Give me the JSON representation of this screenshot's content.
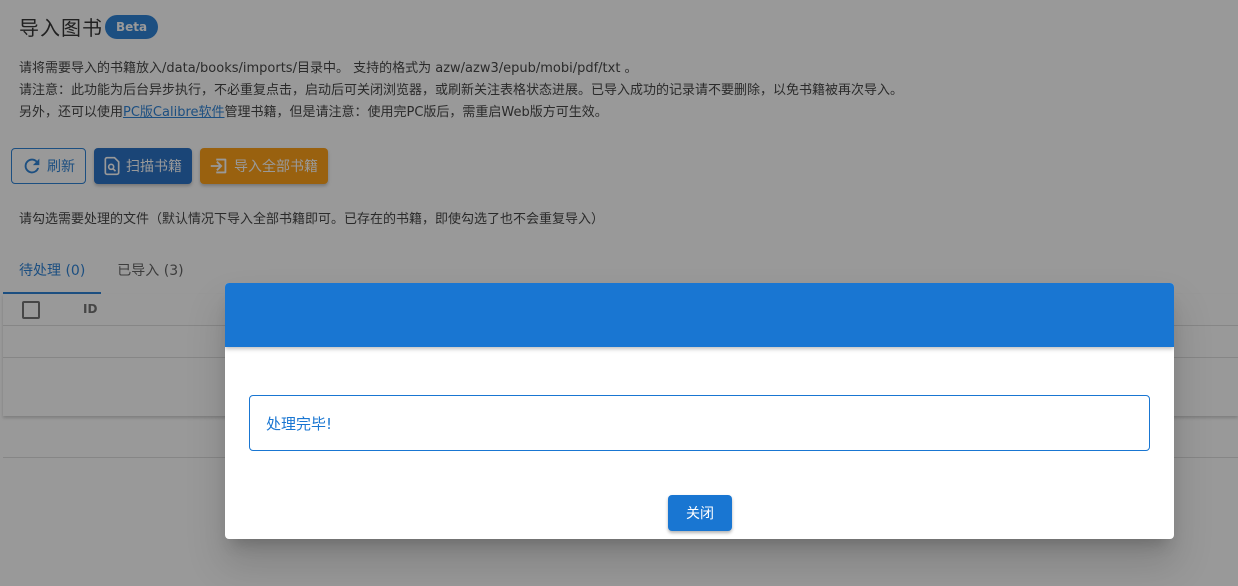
{
  "header": {
    "title": "导入图书",
    "badge": "Beta"
  },
  "notes": {
    "line1": "请将需要导入的书籍放入/data/books/imports/目录中。 支持的格式为 azw/azw3/epub/mobi/pdf/txt 。",
    "line2": "请注意：此功能为后台异步执行，不必重复点击，启动后可关闭浏览器，或刷新关注表格状态进展。已导入成功的记录请不要删除，以免书籍被再次导入。",
    "line3_prefix": "另外，还可以使用",
    "line3_link": "PC版Calibre软件",
    "line3_suffix": "管理书籍，但是请注意：使用完PC版后，需重启Web版方可生效。"
  },
  "toolbar": {
    "refresh_label": "刷新",
    "scan_label": "扫描书籍",
    "import_all_label": "导入全部书籍",
    "colors": {
      "primary": "#1976d2",
      "scan": "#1565c0",
      "import": "#ff9800"
    }
  },
  "hint": "请勾选需要处理的文件（默认情况下导入全部书籍即可。已存在的书籍，即使勾选了也不会重复导入）",
  "tabs": [
    {
      "label": "待处理 (0)",
      "active": true
    },
    {
      "label": "已导入 (3)",
      "active": false
    }
  ],
  "table": {
    "columns": [
      "ID"
    ]
  },
  "dialog": {
    "message": "处理完毕!",
    "close_label": "关闭"
  },
  "icons": [
    "refresh-icon",
    "scan-icon",
    "import-icon"
  ]
}
